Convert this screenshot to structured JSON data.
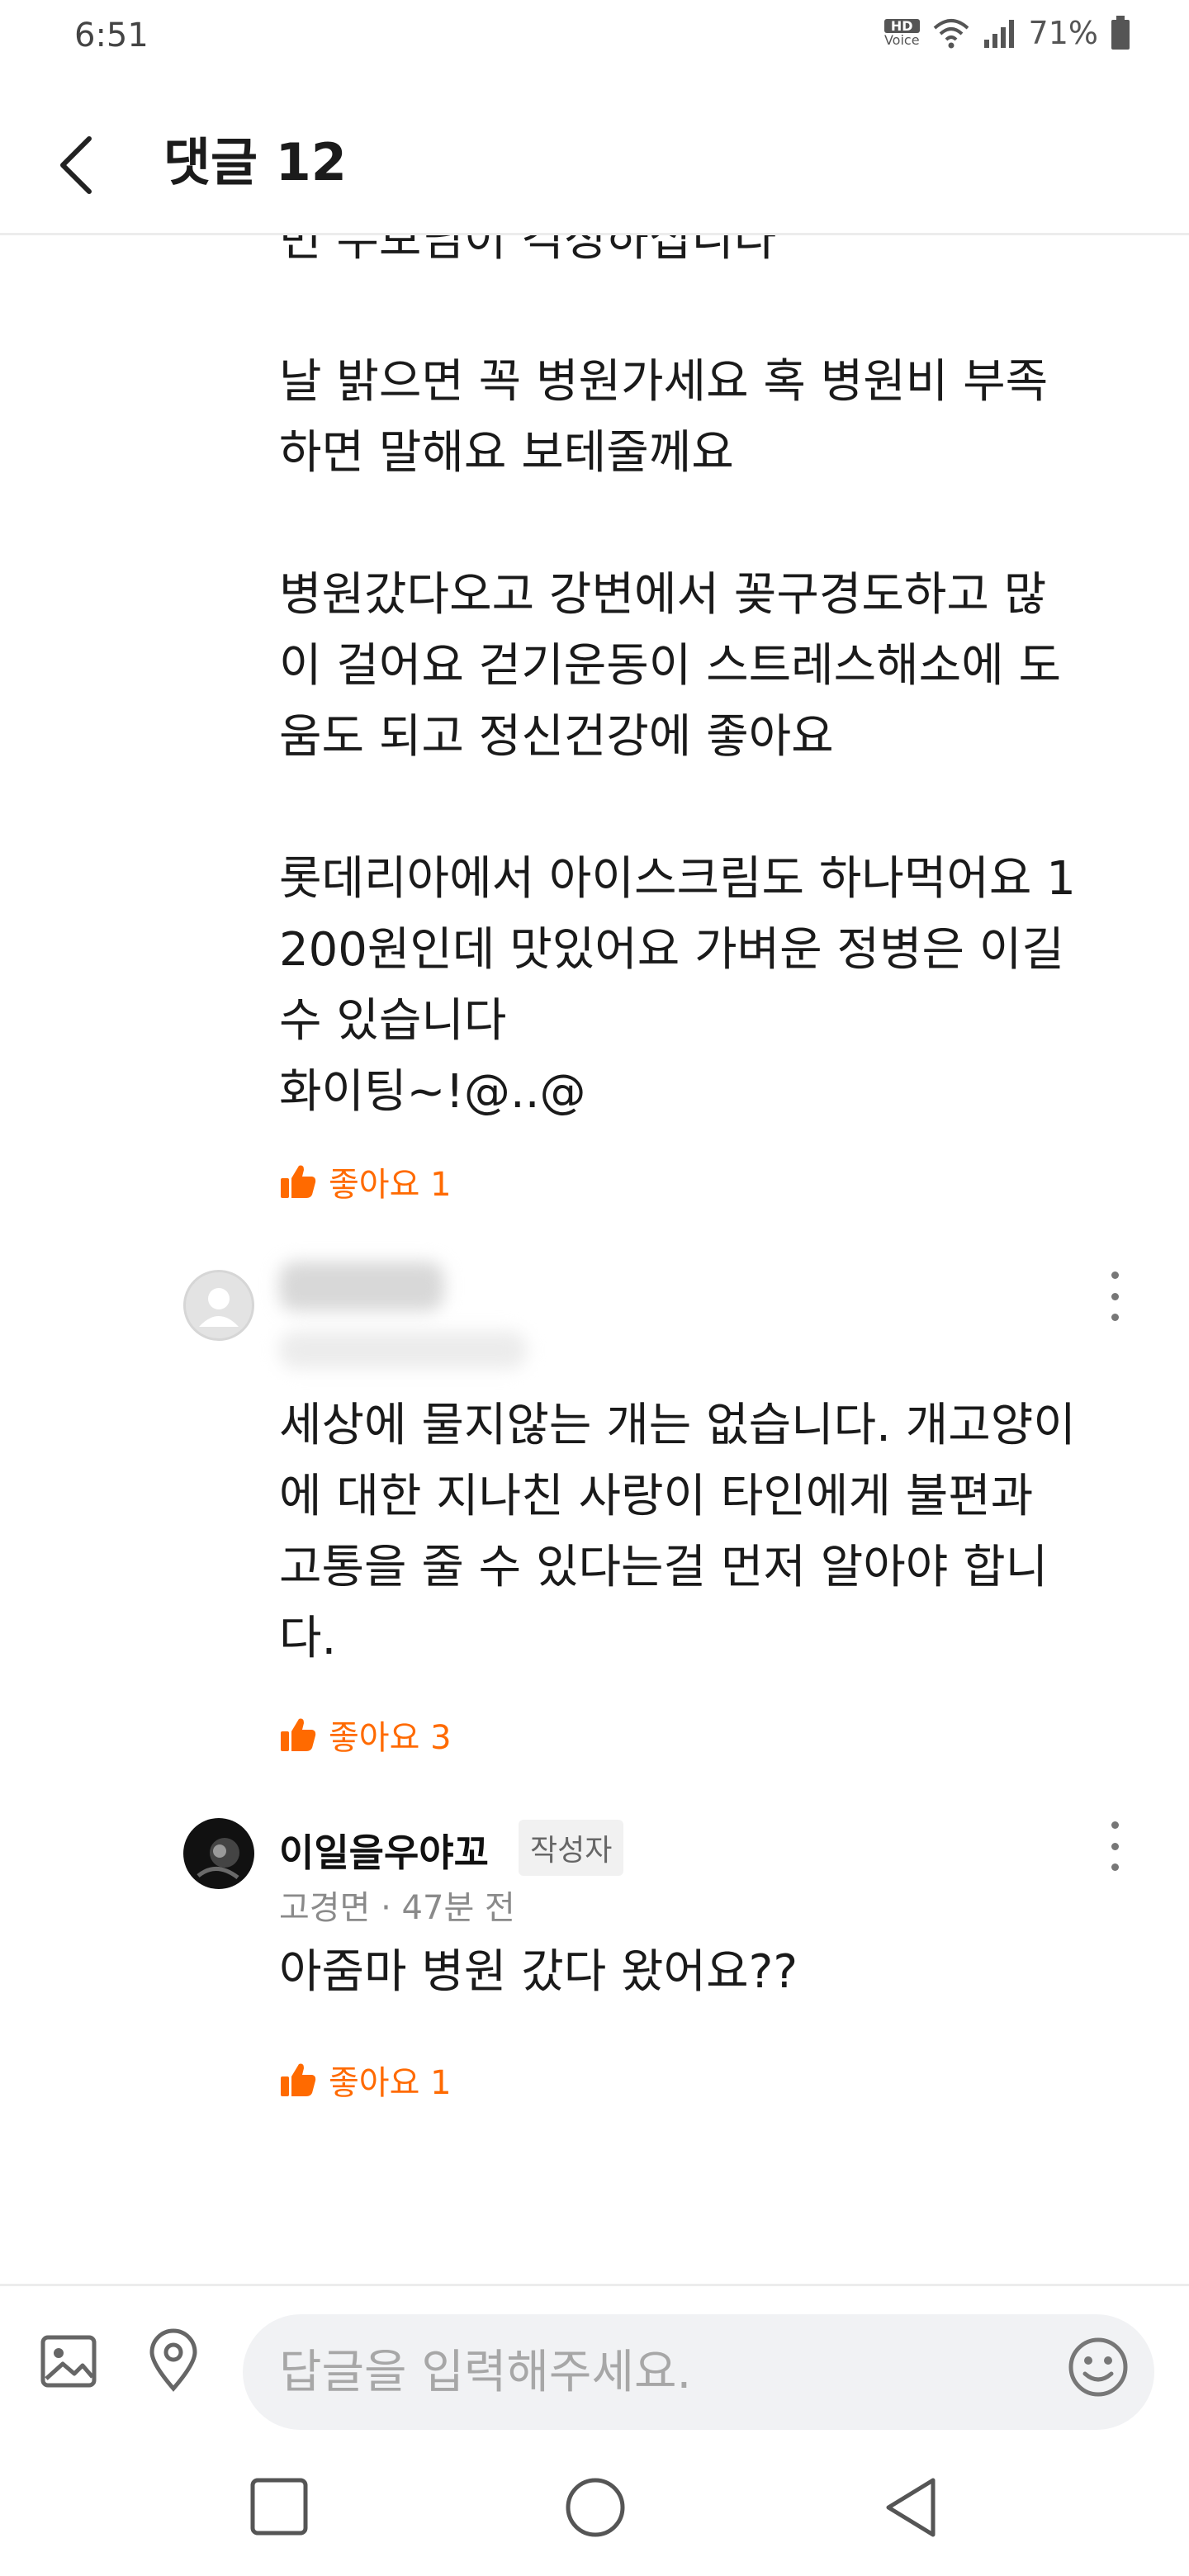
{
  "status_bar": {
    "time": "6:51",
    "hd_label": "HD",
    "voice_label": "Voice",
    "battery": "71%"
  },
  "header": {
    "title": "댓글 12"
  },
  "comments": {
    "first": {
      "clipped_top_line": "번 두보님이 걱정하십니다",
      "body": "날 밝으면 꼭 병원가세요 혹 병원비 부족\n하면 말해요 보테줄께요\n\n병원갔다오고 강변에서 꽂구경도하고 많\n이 걸어요 걷기운동이 스트레스해소에 도\n움도 되고 정신건강에 좋아요\n\n롯데리아에서 아이스크림도 하나먹어요 1\n200원인데 맛있어요 가벼운 정병은 이길\n수 있습니다\n화이팅~!@..@",
      "like_label": "좋아요 1"
    },
    "second": {
      "body": "세상에 물지않는 개는 없습니다. 개고양이\n에 대한 지나친 사랑이 타인에게 불편과\n고통을 줄 수 있다는걸 먼저 알아야 합니\n다.",
      "like_label": "좋아요 3"
    },
    "third": {
      "author": "이일을우야꼬",
      "badge": "작성자",
      "meta": "고경면 · 47분 전",
      "body": "아줌마 병원 갔다 왔어요??",
      "like_label": "좋아요 1"
    }
  },
  "input_bar": {
    "placeholder": "답글을 입력해주세요."
  },
  "colors": {
    "accent": "#ff6a00",
    "text": "#1a1a1a",
    "muted": "#8a8a8a",
    "input_bg": "#f1f2f4"
  }
}
